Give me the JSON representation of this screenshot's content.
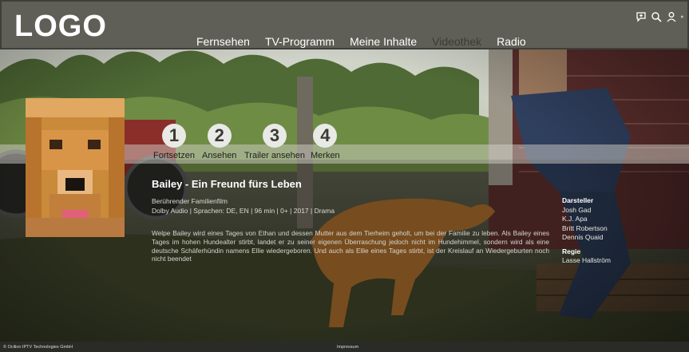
{
  "header": {
    "logo": "LOGO",
    "nav": [
      "Fernsehen",
      "TV-Programm",
      "Meine Inhalte",
      "Videothek",
      "Radio"
    ],
    "active_nav": "Videothek",
    "icons": [
      "chat-plus-icon",
      "search-icon",
      "user-icon",
      "settings-icon"
    ]
  },
  "actions": [
    {
      "num": "1",
      "label": "Fortsetzen"
    },
    {
      "num": "2",
      "label": "Ansehen"
    },
    {
      "num": "3",
      "label": "Trailer ansehen"
    },
    {
      "num": "4",
      "label": "Merken"
    }
  ],
  "movie": {
    "title": "Bailey - Ein Freund fürs Leben",
    "genre": "Berührender Familienfilm",
    "meta": "Dolby Audio | Sprachen: DE, EN | 96 min | 0+ | 2017 | Drama",
    "description": "Welpe Bailey wird eines Tages von Ethan und dessen Mutter aus dem Tierheim geholt, um bei der Familie zu leben. Als Bailey eines Tages im hohen Hundealter stirbt, landet er zu seiner eigenen Überraschung jedoch nicht im Hundehimmel, sondern wird als eine deutsche Schäferhündin namens Ellie wiedergeboren. Und auch als Ellie eines Tages stirbt, ist der Kreislauf an Wiedergeburten noch nicht beendet"
  },
  "credits": {
    "cast_heading": "Darsteller",
    "cast": [
      "Josh Gad",
      "K.J. Apa",
      "Britt Robertson",
      "Dennis Quaid"
    ],
    "director_heading": "Regie",
    "director": "Lasse Hallström"
  },
  "footer": {
    "copyright": "© Ocilion IPTV Technologies GmbH",
    "impressum": "Impressum"
  }
}
